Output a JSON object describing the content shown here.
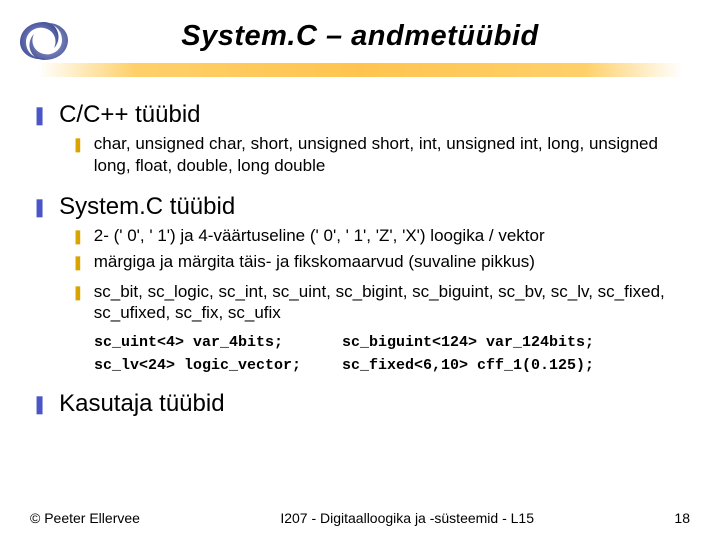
{
  "title": "System.C – andmetüübid",
  "sections": {
    "s0": {
      "heading": "C/C++ tüübid",
      "items": [
        "char, unsigned char, short, unsigned short, int, unsigned int, long, unsigned long, float, double, long double"
      ]
    },
    "s1": {
      "heading": "System.C tüübid",
      "items": [
        "2- (' 0', ' 1') ja 4-väärtuseline (' 0', ' 1', 'Z', 'X')  loogika / vektor",
        "märgiga ja märgita täis- ja fikskomaarvud (suvaline pikkus)",
        "sc_bit, sc_logic, sc_int, sc_uint, sc_bigint, sc_biguint, sc_bv, sc_lv, sc_fixed, sc_ufixed, sc_fix, sc_ufix"
      ],
      "code": [
        {
          "c1": "sc_uint<4> var_4bits;",
          "c2": "sc_biguint<124> var_124bits;"
        },
        {
          "c1": "sc_lv<24> logic_vector;",
          "c2": "sc_fixed<6,10> cff_1(0.125);"
        }
      ]
    },
    "s2": {
      "heading": "Kasutaja tüübid"
    }
  },
  "footer": {
    "left": "© Peeter Ellervee",
    "center": "I207 - Digitaalloogika ja -süsteemid - L15",
    "right": "18"
  }
}
